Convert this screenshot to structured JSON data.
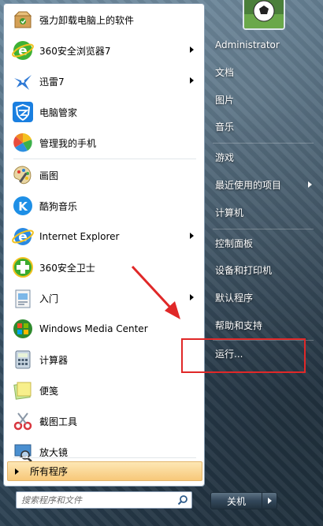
{
  "pinned_programs": [
    {
      "label": "强力卸载电脑上的软件",
      "icon": "uninstaller-box-icon",
      "has_submenu": false
    },
    {
      "label": "360安全浏览器7",
      "icon": "360-browser-icon",
      "has_submenu": true
    },
    {
      "label": "迅雷7",
      "icon": "thunder-bird-icon",
      "has_submenu": true
    },
    {
      "label": "电脑管家",
      "icon": "pc-manager-shield-icon",
      "has_submenu": false
    },
    {
      "label": "管理我的手机",
      "icon": "phone-manager-icon",
      "has_submenu": false
    }
  ],
  "recent_programs": [
    {
      "label": "画图",
      "icon": "paint-palette-icon",
      "has_submenu": false
    },
    {
      "label": "酷狗音乐",
      "icon": "kugou-icon",
      "has_submenu": false
    },
    {
      "label": "Internet Explorer",
      "icon": "internet-explorer-icon",
      "has_submenu": true
    },
    {
      "label": "360安全卫士",
      "icon": "360-safeguard-icon",
      "has_submenu": false
    },
    {
      "label": "入门",
      "icon": "getting-started-icon",
      "has_submenu": true
    },
    {
      "label": "Windows Media Center",
      "icon": "windows-media-center-icon",
      "has_submenu": false
    },
    {
      "label": "计算器",
      "icon": "calculator-icon",
      "has_submenu": false
    },
    {
      "label": "便笺",
      "icon": "sticky-notes-icon",
      "has_submenu": false
    },
    {
      "label": "截图工具",
      "icon": "snipping-tool-icon",
      "has_submenu": false
    },
    {
      "label": "放大镜",
      "icon": "magnifier-icon",
      "has_submenu": false
    }
  ],
  "all_programs_label": "所有程序",
  "search": {
    "placeholder": "搜索程序和文件"
  },
  "right_menu": [
    {
      "label": "Administrator",
      "has_submenu": false
    },
    {
      "label": "文档",
      "has_submenu": false
    },
    {
      "label": "图片",
      "has_submenu": false
    },
    {
      "label": "音乐",
      "has_submenu": false
    },
    {
      "label": "游戏",
      "has_submenu": false
    },
    {
      "label": "最近使用的项目",
      "has_submenu": true
    },
    {
      "label": "计算机",
      "has_submenu": false
    },
    {
      "label": "控制面板",
      "has_submenu": false
    },
    {
      "label": "设备和打印机",
      "has_submenu": false
    },
    {
      "label": "默认程序",
      "has_submenu": false
    },
    {
      "label": "帮助和支持",
      "has_submenu": false
    },
    {
      "label": "运行...",
      "has_submenu": false
    }
  ],
  "shutdown_label": "关机",
  "annotation": {
    "color": "#e02828",
    "highlighted_item": "运行..."
  }
}
